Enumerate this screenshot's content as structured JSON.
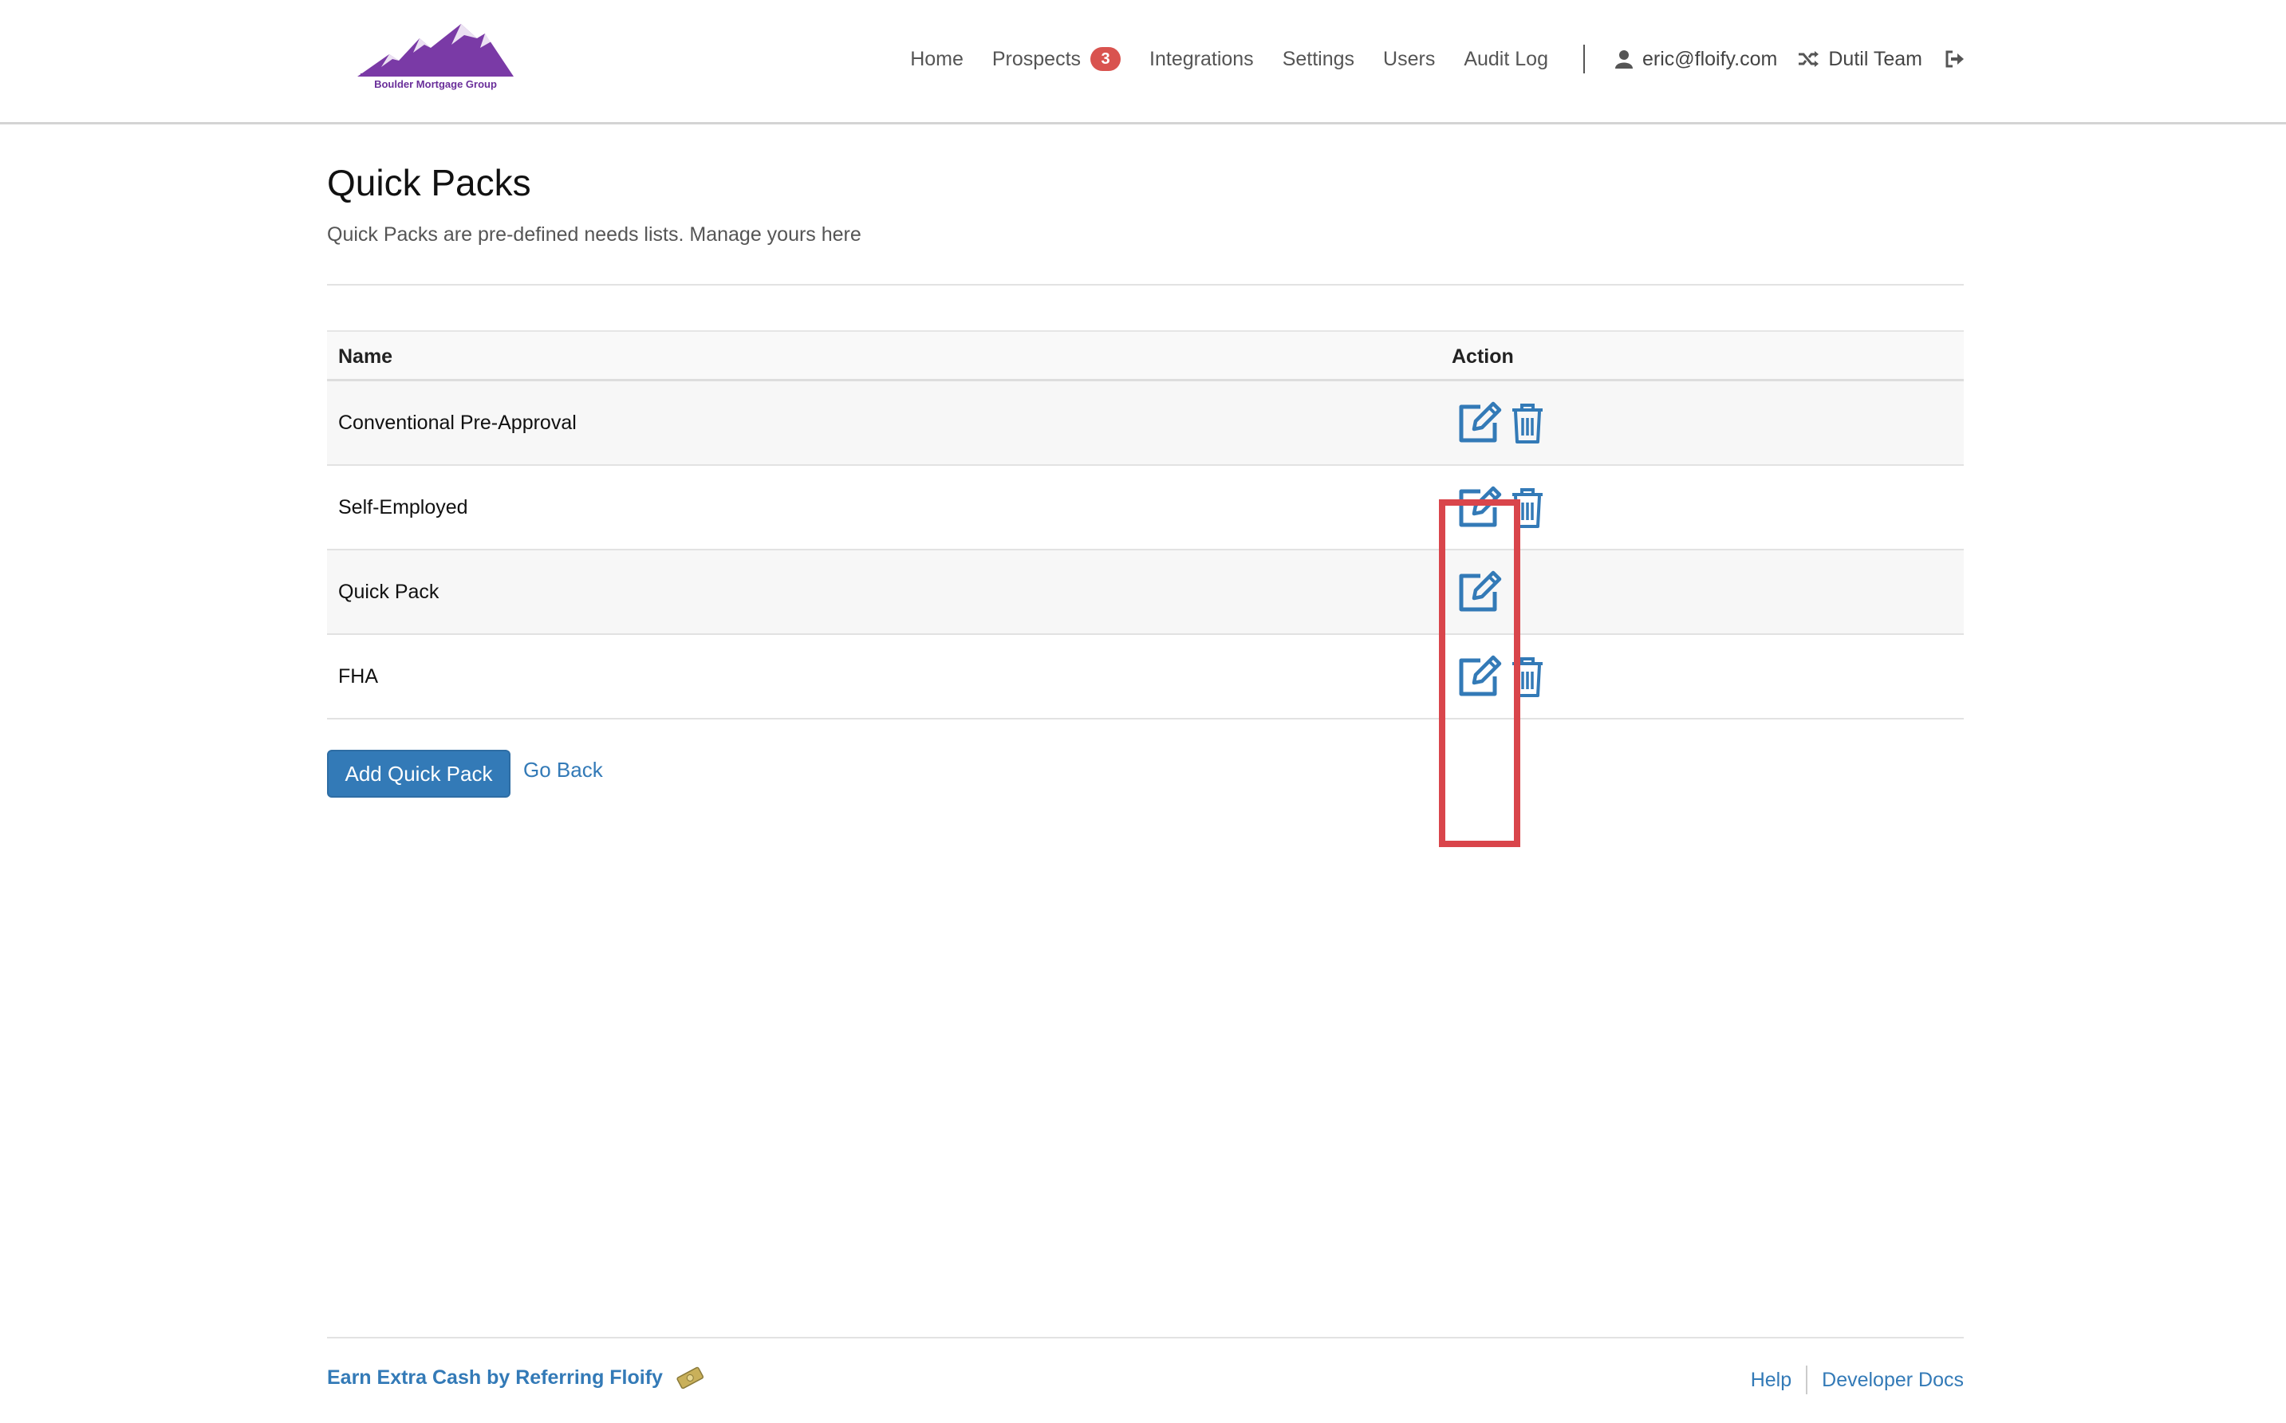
{
  "brand": {
    "logo_text": "Boulder Mortgage Group",
    "color": "#7a3aa6"
  },
  "nav": {
    "home": "Home",
    "prospects": "Prospects",
    "prospects_badge": "3",
    "integrations": "Integrations",
    "settings": "Settings",
    "users": "Users",
    "audit_log": "Audit Log",
    "user_email": "eric@floify.com",
    "team": "Dutil Team"
  },
  "page": {
    "title": "Quick Packs",
    "subtitle": "Quick Packs are pre-defined needs lists. Manage yours here"
  },
  "table": {
    "headers": {
      "name": "Name",
      "action": "Action"
    },
    "rows": [
      {
        "name": "Conventional Pre-Approval",
        "can_delete": true
      },
      {
        "name": "Self-Employed",
        "can_delete": true
      },
      {
        "name": "Quick Pack",
        "can_delete": false
      },
      {
        "name": "FHA",
        "can_delete": true
      }
    ]
  },
  "buttons": {
    "add": "Add Quick Pack",
    "back": "Go Back"
  },
  "footer": {
    "referral": "Earn Extra Cash by Referring Floify",
    "help": "Help",
    "docs": "Developer Docs"
  },
  "colors": {
    "link": "#337ab7",
    "primary": "#337ab7",
    "badge": "#d9534f",
    "highlight": "#d9454b"
  }
}
